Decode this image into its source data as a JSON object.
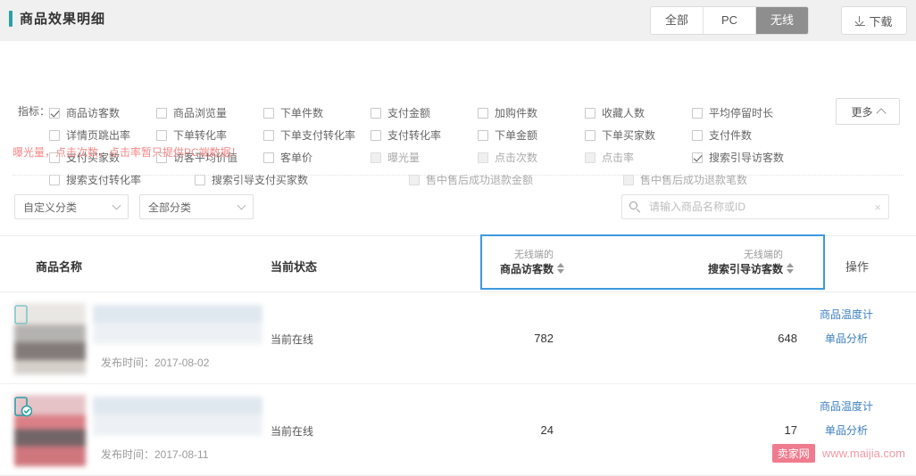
{
  "header": {
    "title": "商品效果明细",
    "segments": [
      {
        "label": "全部",
        "active": false
      },
      {
        "label": "PC",
        "active": false
      },
      {
        "label": "无线",
        "active": true
      }
    ],
    "download_label": "下载"
  },
  "metrics": {
    "label": "指标：",
    "more_label": "更多",
    "warning": "曝光量，点击次数，点击率暂只提供PC端数据！",
    "rows": [
      [
        {
          "label": "商品访客数",
          "checked": true,
          "disabled": false
        },
        {
          "label": "商品浏览量",
          "checked": false,
          "disabled": false
        },
        {
          "label": "下单件数",
          "checked": false,
          "disabled": false
        },
        {
          "label": "支付金额",
          "checked": false,
          "disabled": false
        },
        {
          "label": "加购件数",
          "checked": false,
          "disabled": false
        },
        {
          "label": "收藏人数",
          "checked": false,
          "disabled": false
        },
        {
          "label": "平均停留时长",
          "checked": false,
          "disabled": false
        }
      ],
      [
        {
          "label": "详情页跳出率",
          "checked": false,
          "disabled": false
        },
        {
          "label": "下单转化率",
          "checked": false,
          "disabled": false
        },
        {
          "label": "下单支付转化率",
          "checked": false,
          "disabled": false
        },
        {
          "label": "支付转化率",
          "checked": false,
          "disabled": false
        },
        {
          "label": "下单金额",
          "checked": false,
          "disabled": false
        },
        {
          "label": "下单买家数",
          "checked": false,
          "disabled": false
        },
        {
          "label": "支付件数",
          "checked": false,
          "disabled": false
        }
      ],
      [
        {
          "label": "支付买家数",
          "checked": false,
          "disabled": false
        },
        {
          "label": "访客平均价值",
          "checked": false,
          "disabled": false
        },
        {
          "label": "客单价",
          "checked": false,
          "disabled": false
        },
        {
          "label": "曝光量",
          "checked": false,
          "disabled": true
        },
        {
          "label": "点击次数",
          "checked": false,
          "disabled": true
        },
        {
          "label": "点击率",
          "checked": false,
          "disabled": true
        },
        {
          "label": "搜索引导访客数",
          "checked": true,
          "disabled": false
        }
      ],
      [
        {
          "label": "搜索支付转化率",
          "checked": false,
          "disabled": false
        },
        {
          "label": "搜索引导支付买家数",
          "checked": false,
          "disabled": false
        },
        {
          "label": "售中售后成功退款金额",
          "checked": false,
          "disabled": true
        },
        {
          "label": "售中售后成功退款笔数",
          "checked": false,
          "disabled": true
        }
      ]
    ]
  },
  "filters": {
    "custom_category": "自定义分类",
    "all_category": "全部分类",
    "search_placeholder": "请输入商品名称或ID",
    "search_value": "",
    "clear_label": "×"
  },
  "table": {
    "columns": {
      "name": "商品名称",
      "status": "当前状态",
      "metric1_sub": "无线端的",
      "metric1_main": "商品访客数",
      "metric2_sub": "无线端的",
      "metric2_main": "搜索引导访客数",
      "action": "操作"
    },
    "highlight_color": "#3d9ae0",
    "rows": [
      {
        "publish_time": "发布时间：2017-08-02",
        "status": "当前在线",
        "metric1": "782",
        "metric2": "648",
        "action1": "商品温度计",
        "action2": "单品分析",
        "has_mobile_badge": false
      },
      {
        "publish_time": "发布时间：2017-08-11",
        "status": "当前在线",
        "metric1": "24",
        "metric2": "17",
        "action1": "商品温度计",
        "action2": "单品分析",
        "has_mobile_badge": true
      }
    ]
  },
  "watermark": {
    "badge": "卖家网",
    "text": "www.maijia.com"
  }
}
